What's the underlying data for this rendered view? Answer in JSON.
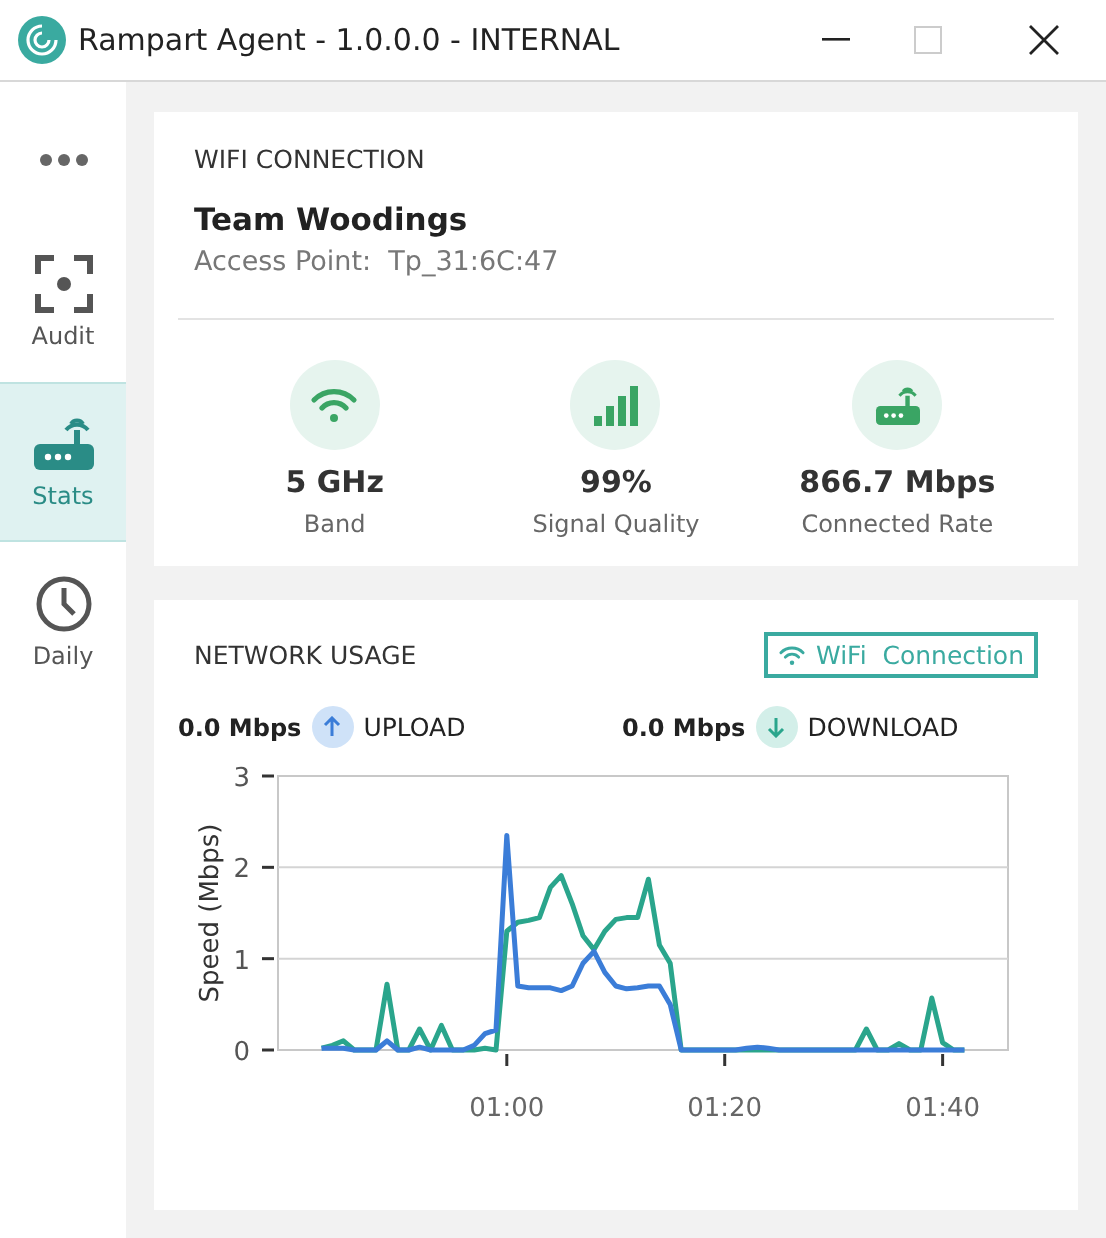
{
  "window": {
    "title": "Rampart Agent - 1.0.0.0 - INTERNAL",
    "maximize_disabled": true
  },
  "sidebar": {
    "items": [
      {
        "kind": "audit",
        "label": "Audit",
        "selected": false
      },
      {
        "kind": "stats",
        "label": "Stats",
        "selected": true
      },
      {
        "kind": "daily",
        "label": "Daily",
        "selected": false
      }
    ]
  },
  "wifi": {
    "heading": "WIFI CONNECTION",
    "network": "Team Woodings",
    "access_point": "Access Point:  Tp_31:6C:47",
    "stats": [
      {
        "kind": "wifi",
        "value": "5 GHz",
        "label": "Band"
      },
      {
        "kind": "signal",
        "value": "99%",
        "label": "Signal Quality"
      },
      {
        "kind": "router",
        "value": "866.7 Mbps",
        "label": "Connected Rate"
      }
    ]
  },
  "usage": {
    "heading": "NETWORK USAGE",
    "button": "WiFi  Connection",
    "legend": [
      {
        "kind": "upload",
        "value": "0.0 Mbps",
        "label": "UPLOAD"
      },
      {
        "kind": "download",
        "value": "0.0 Mbps",
        "label": "DOWNLOAD"
      }
    ],
    "chart_data": {
      "type": "line",
      "ylabel": "Speed (Mbps)",
      "x": [
        43,
        44,
        45,
        46,
        47,
        48,
        49,
        50,
        51,
        52,
        53,
        54,
        55,
        56,
        57,
        58,
        59,
        60,
        61,
        62,
        63,
        64,
        65,
        66,
        67,
        68,
        69,
        70,
        71,
        72,
        73,
        74,
        75,
        76,
        77,
        78,
        79,
        80,
        81,
        82,
        83,
        84,
        85,
        86,
        87,
        88,
        89,
        90,
        91,
        92,
        93,
        94,
        95,
        96,
        97,
        98,
        99,
        100,
        101,
        102
      ],
      "series": [
        {
          "color": "#2aa58c",
          "values": [
            0.02,
            0.05,
            0.1,
            0,
            0,
            0,
            0.72,
            0,
            0,
            0.23,
            0,
            0.27,
            0,
            0,
            0,
            0.02,
            0,
            1.3,
            1.4,
            1.42,
            1.45,
            1.78,
            1.91,
            1.6,
            1.25,
            1.1,
            1.3,
            1.43,
            1.45,
            1.45,
            1.87,
            1.15,
            0.95,
            0,
            0,
            0,
            0,
            0,
            0,
            0,
            0,
            0,
            0,
            0,
            0,
            0,
            0,
            0,
            0,
            0,
            0.23,
            0,
            0,
            0.07,
            0,
            0,
            0.57,
            0.08,
            0,
            0
          ]
        },
        {
          "color": "#3b7dd8",
          "values": [
            0.02,
            0.02,
            0.02,
            0,
            0,
            0,
            0.1,
            0,
            0,
            0.03,
            0,
            0,
            0,
            0,
            0.05,
            0.18,
            0.22,
            2.35,
            0.7,
            0.68,
            0.68,
            0.68,
            0.65,
            0.7,
            0.95,
            1.08,
            0.85,
            0.7,
            0.67,
            0.68,
            0.7,
            0.7,
            0.5,
            0,
            0,
            0,
            0,
            0,
            0,
            0.02,
            0.03,
            0.02,
            0,
            0,
            0,
            0,
            0,
            0,
            0,
            0,
            0,
            0,
            0,
            0,
            0,
            0,
            0,
            0,
            0,
            0
          ]
        }
      ],
      "xlim": [
        39,
        106
      ],
      "ylim": [
        0,
        3
      ],
      "yticks": [
        0,
        1,
        2,
        3
      ],
      "xticks": [
        {
          "value": 60,
          "label": "01:00"
        },
        {
          "value": 80,
          "label": "01:20"
        },
        {
          "value": 100,
          "label": "01:40"
        }
      ]
    }
  }
}
